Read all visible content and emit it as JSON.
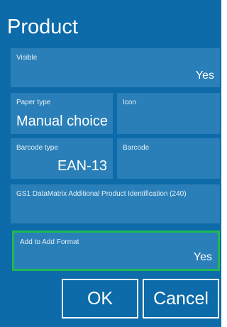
{
  "dialog": {
    "title": "Product"
  },
  "fields": {
    "visible": {
      "label": "Visible",
      "value": "Yes"
    },
    "paper_type": {
      "label": "Paper type",
      "value": "Manual choice"
    },
    "icon": {
      "label": "Icon",
      "value": ""
    },
    "barcode_type": {
      "label": "Barcode type",
      "value": "EAN-13"
    },
    "barcode": {
      "label": "Barcode",
      "value": ""
    },
    "gs1": {
      "label": "GS1 DataMatrix Additional Product Identification (240)",
      "value": ""
    },
    "add_to_add_format": {
      "label": "Add to Add Format",
      "value": "Yes"
    }
  },
  "buttons": {
    "ok": "OK",
    "cancel": "Cancel"
  },
  "colors": {
    "background": "#0e6ba9",
    "tile": "#2a7fb8",
    "highlight": "#1db954"
  }
}
